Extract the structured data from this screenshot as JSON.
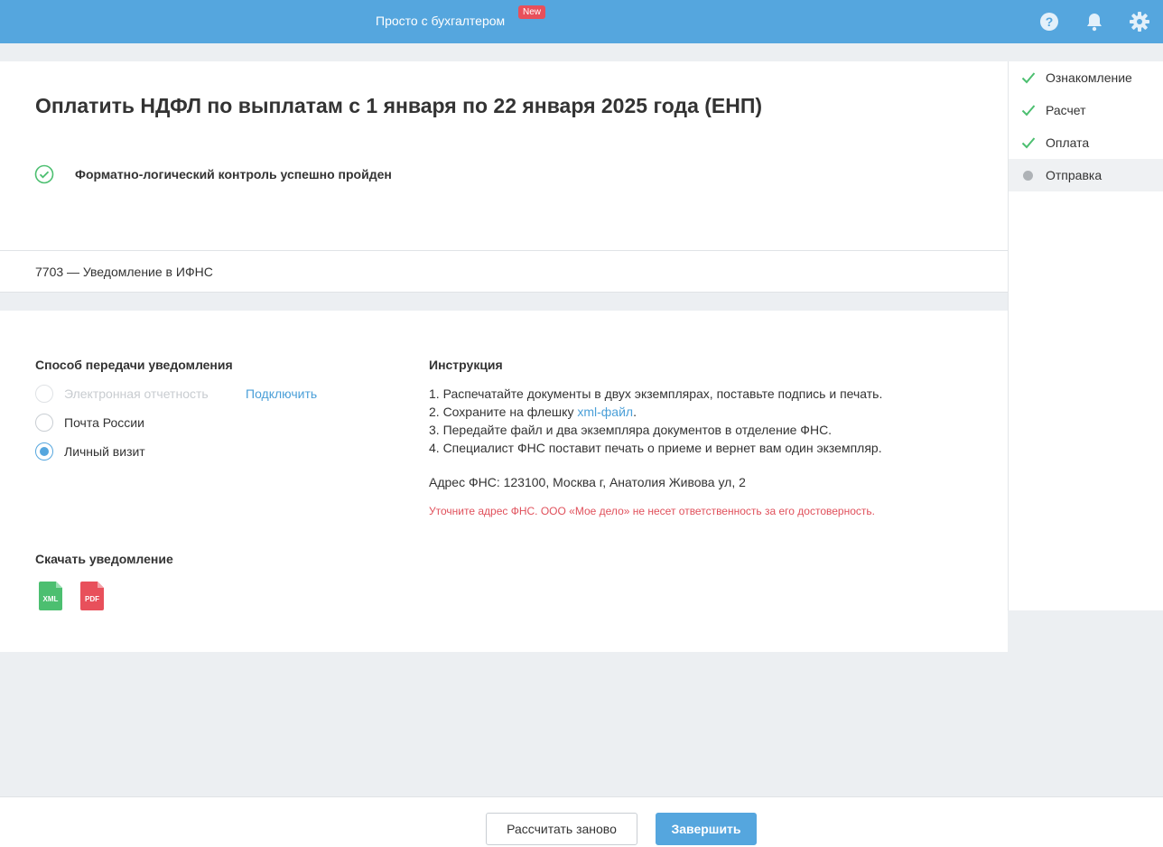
{
  "header": {
    "title": "Просто с бухгалтером",
    "badge": "New",
    "icons": [
      "help-icon",
      "bell-icon",
      "gear-icon"
    ],
    "bg_color": "#55a6de"
  },
  "main": {
    "title": "Оплатить НДФЛ по выплатам с 1 января по 22 января 2025 года (ЕНП)",
    "check_status": "Форматно-логический контроль успешно пройден",
    "document": "7703 — Уведомление в ИФНС"
  },
  "transfer": {
    "heading": "Способ передачи уведомления",
    "options": [
      {
        "label": "Электронная отчетность",
        "disabled": true,
        "checked": false
      },
      {
        "label": "Почта России",
        "disabled": false,
        "checked": false
      },
      {
        "label": "Личный визит",
        "disabled": false,
        "checked": true
      }
    ],
    "connect_link": "Подключить"
  },
  "instructions": {
    "heading": "Инструкция",
    "step1": "1. Распечатайте документы в двух экземплярах, поставьте подпись и печать.",
    "step2_before": "2. Сохраните на флешку ",
    "step2_link": "xml-файл",
    "step2_after": ".",
    "step3": "3. Передайте файл и два экземпляра документов в отделение ФНС.",
    "step4": "4. Специалист ФНС поставит печать о приеме и вернет вам один экземпляр.",
    "address": "Адрес ФНС: 123100, Москва г, Анатолия Живова ул, 2",
    "warning": "Уточните адрес ФНС. ООО «Мое дело» не несет ответственность за его достоверность."
  },
  "download": {
    "heading": "Скачать уведомление",
    "xml_label": "XML",
    "pdf_label": "PDF",
    "xml_color": "#4cbf70",
    "pdf_color": "#e8505b"
  },
  "steps": [
    {
      "label": "Ознакомление",
      "status": "done"
    },
    {
      "label": "Расчет",
      "status": "done"
    },
    {
      "label": "Оплата",
      "status": "done"
    },
    {
      "label": "Отправка",
      "status": "current"
    }
  ],
  "footer": {
    "recalc_label": "Рассчитать заново",
    "finish_label": "Завершить"
  }
}
